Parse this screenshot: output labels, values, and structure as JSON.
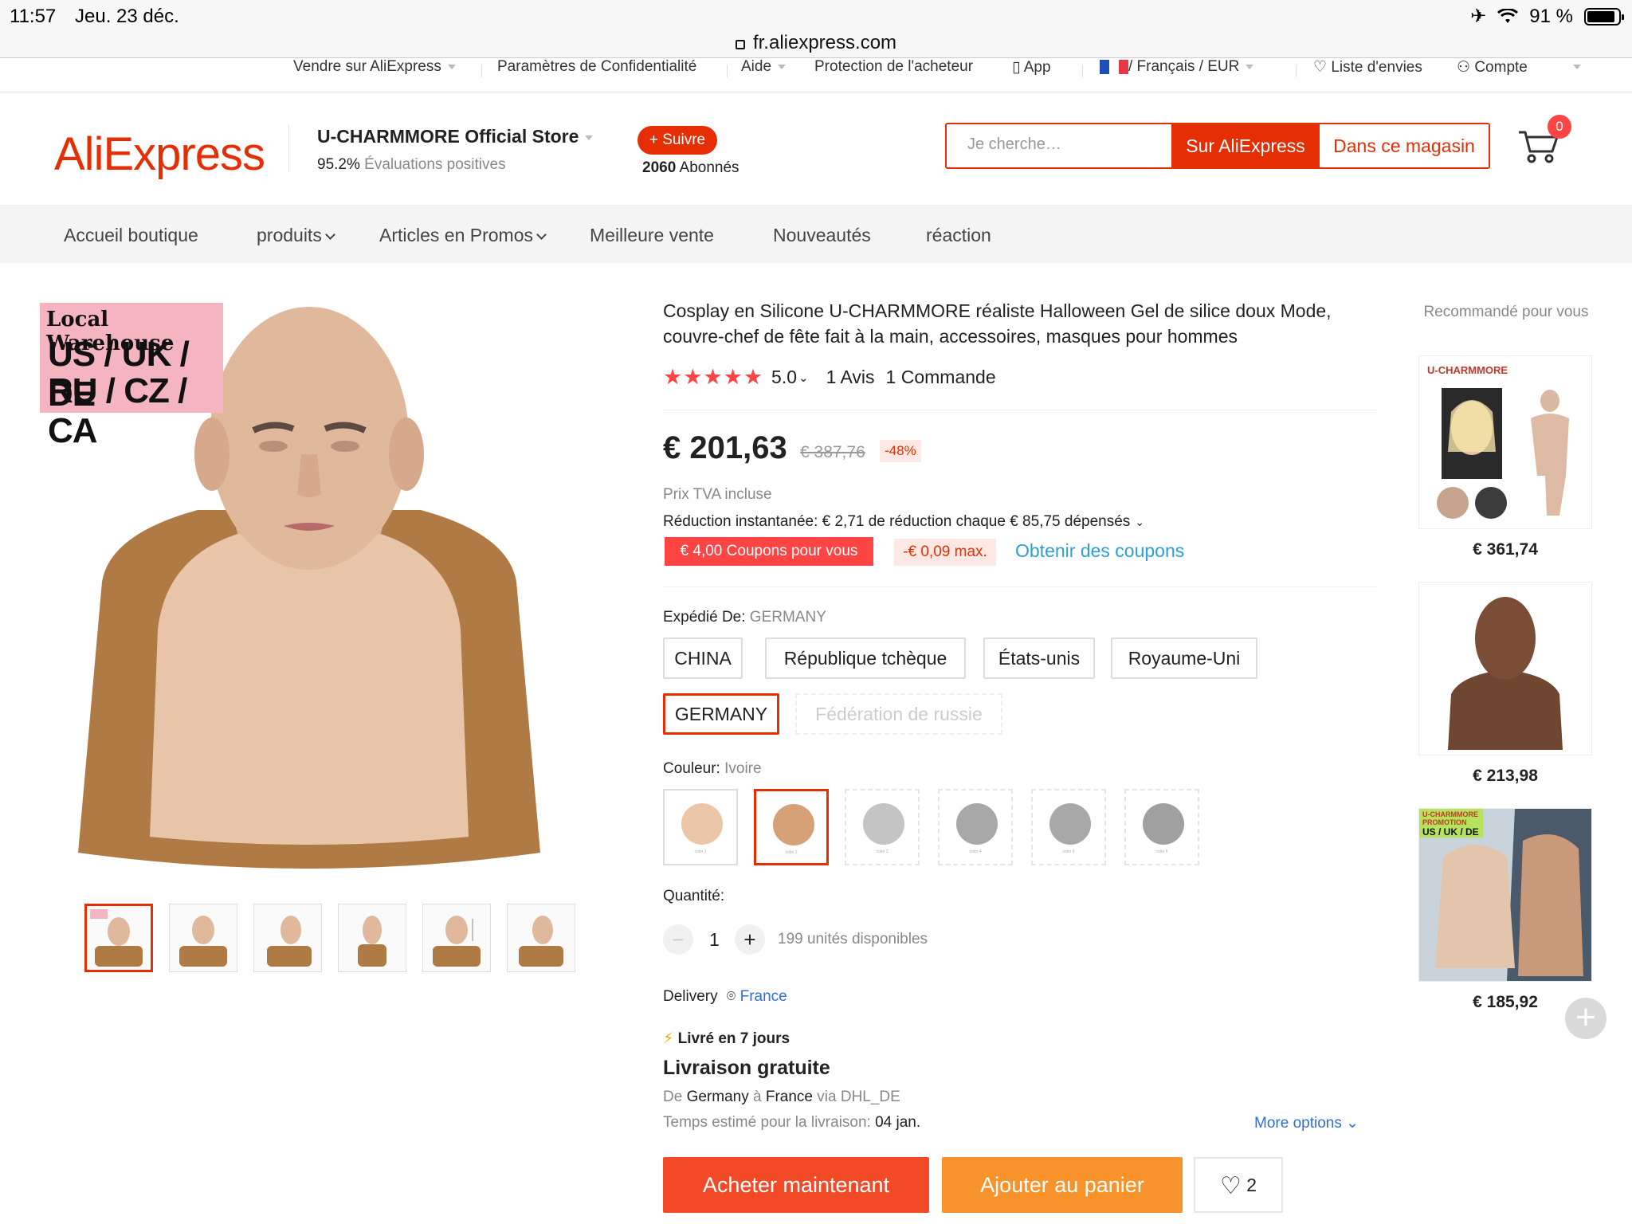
{
  "statusbar": {
    "time": "11:57",
    "date": "Jeu. 23 déc.",
    "battery": "91 %"
  },
  "url": "fr.aliexpress.com",
  "topnav": {
    "sell": "Vendre sur AliExpress",
    "privacy": "Paramètres de Confidentialité",
    "help": "Aide",
    "protection": "Protection de l'acheteur",
    "app": "App",
    "lang": "/ Français / EUR",
    "wishlist": "Liste d'envies",
    "account": "Compte"
  },
  "header": {
    "logo": "AliExpress",
    "store_name": "U-CHARMMORE Official Store",
    "rating_value": "95.2%",
    "rating_label": "Évaluations positives",
    "follow_label": "+ Suivre",
    "followers_count": "2060",
    "followers_label": "Abonnés",
    "search_placeholder": "Je cherche…",
    "search_ali": "Sur AliExpress",
    "search_store": "Dans ce magasin",
    "cart_count": "0"
  },
  "storenav": [
    "Accueil boutique",
    "produits",
    "Articles en Promos",
    "Meilleure vente",
    "Nouveautés",
    "réaction"
  ],
  "gallery": {
    "badge_line1": "Local Warehouse",
    "badge_line2": "US / UK / DE",
    "badge_line3": "RU / CZ / CA"
  },
  "product": {
    "title": "Cosplay en Silicone U-CHARMMORE réaliste Halloween Gel de silice doux Mode, couvre-chef de fête fait à la main, accessoires, masques pour hommes",
    "rating": "5.0",
    "reviews": "1 Avis",
    "orders": "1 Commande",
    "price": "€ 201,63",
    "old_price": "€ 387,76",
    "discount": "-48%",
    "tva": "Prix TVA incluse",
    "reduction": "Réduction instantanée: € 2,71 de réduction chaque € 85,75 dépensés",
    "coupon": "€ 4,00 Coupons pour vous",
    "coupon_max": "-€ 0,09 max.",
    "get_coupons": "Obtenir des coupons",
    "ship_from_label": "Expédié De:",
    "ship_from_value": "GERMANY",
    "ship_options": [
      "CHINA",
      "République tchèque",
      "États-unis",
      "Royaume-Uni",
      "GERMANY",
      "Fédération de russie"
    ],
    "color_label": "Couleur:",
    "color_value": "Ivoire",
    "swatch_labels": [
      "color 1",
      "color 2",
      "color 3",
      "color 4",
      "color 5",
      "color 6"
    ],
    "qty_label": "Quantité:",
    "qty_value": "1",
    "stock": "199 unités disponibles",
    "delivery_label": "Delivery",
    "delivery_country": "France",
    "delivery_time": "Livré en 7 jours",
    "free_shipping": "Livraison gratuite",
    "route_de": "De",
    "route_from": "Germany",
    "route_a": "à",
    "route_to": "France",
    "route_via": "via DHL_DE",
    "estimate_label": "Temps estimé pour la livraison:",
    "estimate_date": "04 jan.",
    "more_options": "More options",
    "buy_now": "Acheter maintenant",
    "add_cart": "Ajouter au panier",
    "wish_count": "2"
  },
  "recommended": {
    "title": "Recommandé pour vous",
    "items": [
      {
        "price": "€ 361,74",
        "brand": "U-CHARMMORE"
      },
      {
        "price": "€ 213,98"
      },
      {
        "price": "€ 185,92",
        "brand": "U-CHARMMORE PROMOTION",
        "tag": "US / UK / DE"
      }
    ]
  },
  "colors": {
    "accent": "#e62e04",
    "link": "#2e9fd6",
    "buy": "#f24a26",
    "cart": "#f7932a"
  }
}
